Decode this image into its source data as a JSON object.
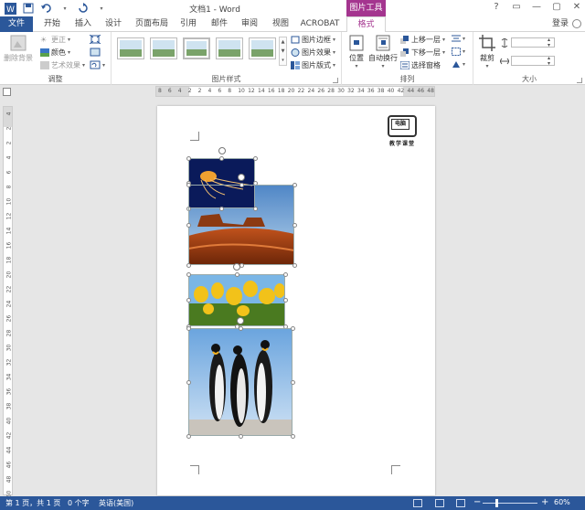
{
  "window": {
    "title": "文档1 - Word",
    "context_tab_group": "图片工具",
    "controls": [
      "?",
      "▭",
      "—",
      "▢",
      "✕"
    ]
  },
  "tabs": [
    {
      "label": "文件"
    },
    {
      "label": "开始"
    },
    {
      "label": "插入"
    },
    {
      "label": "设计"
    },
    {
      "label": "页面布局"
    },
    {
      "label": "引用"
    },
    {
      "label": "邮件"
    },
    {
      "label": "审阅"
    },
    {
      "label": "视图"
    },
    {
      "label": "ACROBAT"
    },
    {
      "label": "格式"
    }
  ],
  "account": {
    "login": "登录"
  },
  "ribbon": {
    "adjust": {
      "label": "调整",
      "remove_bg": "删除背景",
      "correct": "更正",
      "color": "颜色",
      "artistic": "艺术效果"
    },
    "styles": {
      "label": "图片样式",
      "border": "图片边框",
      "effects": "图片效果",
      "layout": "图片版式"
    },
    "arrange": {
      "label": "排列",
      "position": "位置",
      "wrap": "自动换行",
      "bring_forward": "上移一层",
      "send_backward": "下移一层",
      "selection_pane": "选择窗格"
    },
    "size": {
      "label": "大小",
      "crop": "裁剪"
    }
  },
  "ruler": {
    "h_ticks": [
      "8",
      "6",
      "4",
      "2",
      "2",
      "4",
      "6",
      "8",
      "10",
      "12",
      "14",
      "16",
      "18",
      "20",
      "22",
      "24",
      "26",
      "28",
      "30",
      "32",
      "34",
      "36",
      "38",
      "40",
      "42",
      "44",
      "46",
      "48"
    ],
    "v_ticks": [
      "4",
      "2",
      "2",
      "4",
      "6",
      "8",
      "10",
      "12",
      "14",
      "16",
      "18",
      "20",
      "22",
      "24",
      "26",
      "28",
      "30",
      "32",
      "34",
      "36",
      "38",
      "40",
      "42",
      "44",
      "46",
      "48",
      "50"
    ]
  },
  "document": {
    "logo_title": "电脑",
    "logo_caption": "教学课堂"
  },
  "statusbar": {
    "page": "第 1 页，共 1 页",
    "words": "0 个字",
    "language": "英语(美国)",
    "zoom": "60%"
  },
  "colors": {
    "word_blue": "#2b579a",
    "context_accent": "#a4358f"
  }
}
